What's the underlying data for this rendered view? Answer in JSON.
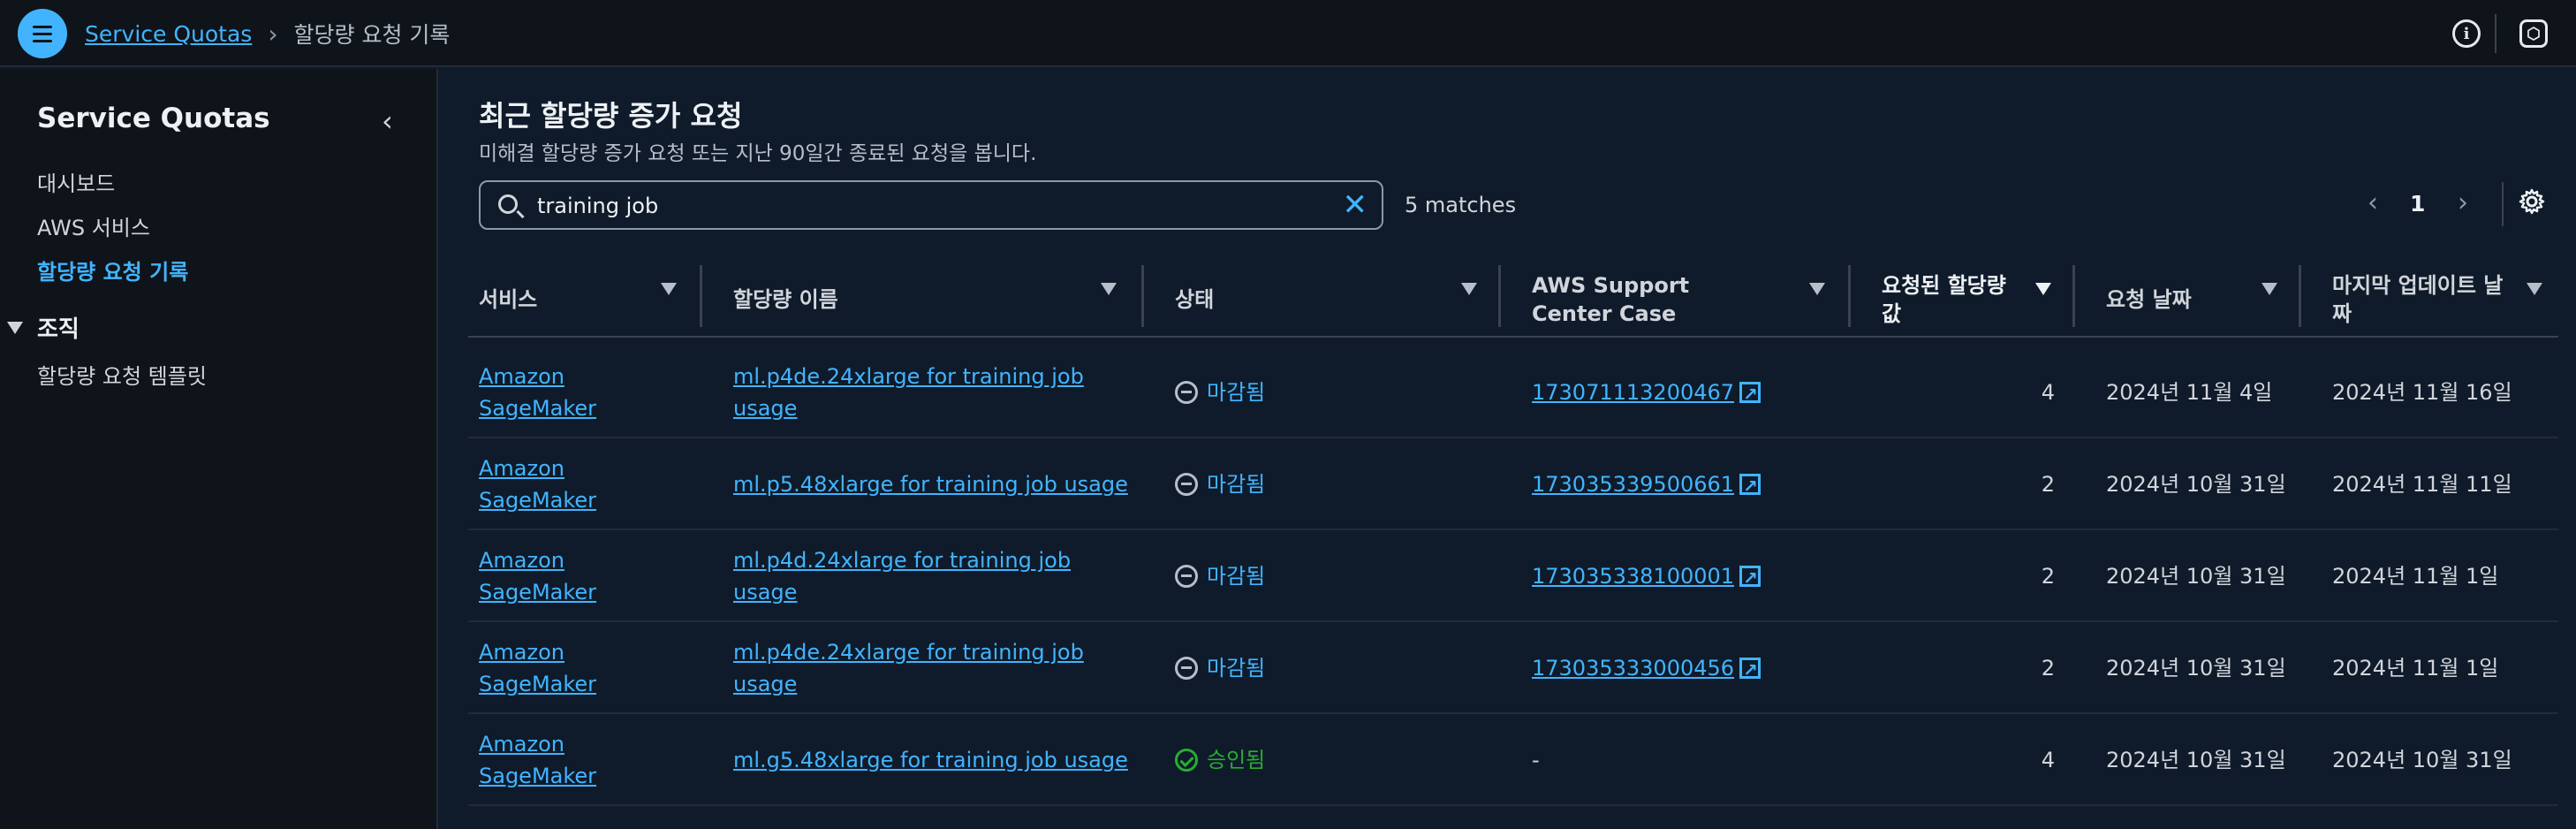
{
  "header": {
    "breadcrumb_root": "Service Quotas",
    "breadcrumb_current": "할당량 요청 기록"
  },
  "sidebar": {
    "title": "Service Quotas",
    "items": [
      {
        "label": "대시보드"
      },
      {
        "label": "AWS 서비스"
      },
      {
        "label": "할당량 요청 기록"
      }
    ],
    "section": {
      "label": "조직",
      "items": [
        {
          "label": "할당량 요청 템플릿"
        }
      ]
    }
  },
  "main": {
    "title": "최근 할당량 증가 요청",
    "description": "미해결 할당량 증가 요청 또는 지난 90일간 종료된 요청을 봅니다.",
    "search": {
      "value": "training job"
    },
    "matches": "5 matches",
    "page": "1"
  },
  "table": {
    "columns": [
      "서비스",
      "할당량 이름",
      "상태",
      "AWS Support Center Case",
      "요청된 할당량 값",
      "요청 날짜",
      "마지막 업데이트 날짜"
    ],
    "rows": [
      {
        "service": "Amazon SageMaker",
        "quota": "ml.p4de.24xlarge for training job usage",
        "status": "마감됨",
        "status_kind": "closed",
        "case": "173071113200467",
        "value": "4",
        "requested": "2024년 11월 4일",
        "updated": "2024년 11월 16일"
      },
      {
        "service": "Amazon SageMaker",
        "quota": "ml.p5.48xlarge for training job usage",
        "status": "마감됨",
        "status_kind": "closed",
        "case": "173035339500661",
        "value": "2",
        "requested": "2024년 10월 31일",
        "updated": "2024년 11월 11일"
      },
      {
        "service": "Amazon SageMaker",
        "quota": "ml.p4d.24xlarge for training job usage",
        "status": "마감됨",
        "status_kind": "closed",
        "case": "173035338100001",
        "value": "2",
        "requested": "2024년 10월 31일",
        "updated": "2024년 11월 1일"
      },
      {
        "service": "Amazon SageMaker",
        "quota": "ml.p4de.24xlarge for training job usage",
        "status": "마감됨",
        "status_kind": "closed",
        "case": "173035333000456",
        "value": "2",
        "requested": "2024년 10월 31일",
        "updated": "2024년 11월 1일"
      },
      {
        "service": "Amazon SageMaker",
        "quota": "ml.g5.48xlarge for training job usage",
        "status": "승인됨",
        "status_kind": "approved",
        "case": "-",
        "value": "4",
        "requested": "2024년 10월 31일",
        "updated": "2024년 10월 31일"
      }
    ]
  },
  "colors": {
    "accent": "#42b4ff",
    "approved": "#29ad32",
    "background": "#0f1b2a"
  },
  "icons": [
    "menu-icon",
    "chevron-right-icon",
    "info-icon",
    "feedback-icon",
    "chevron-left-icon",
    "caret-down-icon",
    "search-icon",
    "close-icon",
    "settings-icon",
    "external-link-icon",
    "status-closed-icon",
    "status-approved-icon"
  ]
}
